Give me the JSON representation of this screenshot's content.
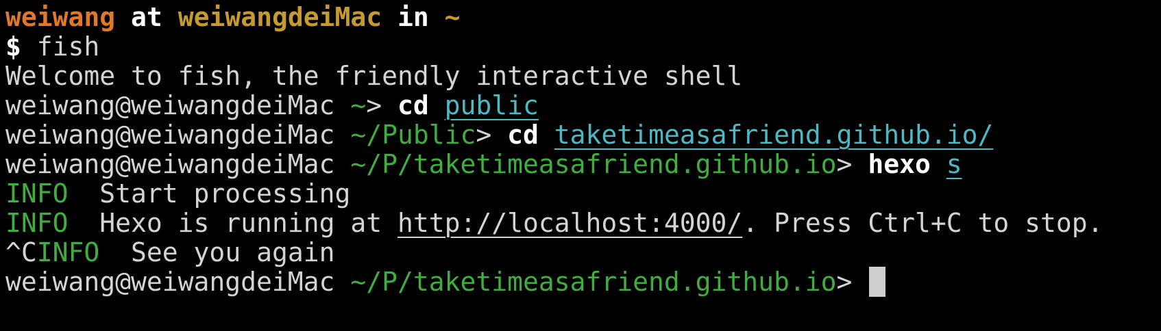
{
  "terminal": {
    "line1": {
      "user": "weiwang",
      "at": "at",
      "host": "weiwangdeiMac",
      "in": "in",
      "dir": "~"
    },
    "line2": {
      "dollar": "$",
      "cmd": "fish"
    },
    "line3": {
      "text": "Welcome to fish, the friendly interactive shell"
    },
    "line4": {
      "user_host": "weiwang@weiwangdeiMac",
      "path": "~",
      "gt": ">",
      "cmd": "cd",
      "arg": "public"
    },
    "line5": {
      "user_host": "weiwang@weiwangdeiMac",
      "path": "~/Public",
      "gt": ">",
      "cmd": "cd",
      "arg": "taketimeasafriend.github.io/"
    },
    "line6": {
      "user_host": "weiwang@weiwangdeiMac",
      "path": "~/P/taketimeasafriend.github.io",
      "gt": ">",
      "cmd": "hexo",
      "arg": "s"
    },
    "line7": {
      "level": "INFO",
      "msg": "Start processing"
    },
    "line8": {
      "level": "INFO",
      "msg_before": "Hexo is running at",
      "url": "http://localhost:4000/",
      "msg_after": ". Press Ctrl+C to stop."
    },
    "line9": {
      "ctrl": "^C",
      "level": "INFO",
      "msg": "See you again"
    },
    "line10": {
      "user_host": "weiwang@weiwangdeiMac",
      "path": "~/P/taketimeasafriend.github.io",
      "gt": ">"
    }
  },
  "colors": {
    "background": "#000000",
    "text": "#d4d4d4",
    "user": "#e0782a",
    "host": "#c69a2e",
    "path": "#3fae3f",
    "argument": "#4cb9c4",
    "info": "#3fae3f",
    "cursor": "#cfcfcf"
  }
}
